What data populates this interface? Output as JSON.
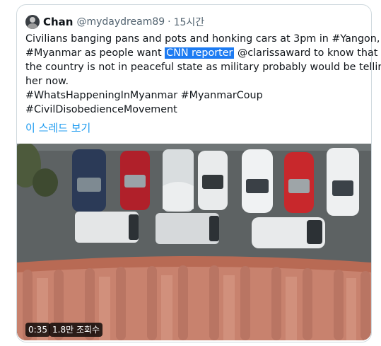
{
  "tweet": {
    "author_name": "Chan",
    "handle": "@mydaydream89",
    "separator": "·",
    "time": "15시간",
    "text_lines": [
      {
        "before": "Civilians banging pans and pots and honking cars at 3pm in #Yangon,",
        "highlight": "",
        "after": ""
      },
      {
        "before": "#Myanmar as people want ",
        "highlight": "CNN reporter",
        "after": " @clarissaward to know that"
      },
      {
        "before": "the country is not in peaceful state as military probably would be telling",
        "highlight": "",
        "after": ""
      },
      {
        "before": "her now.",
        "highlight": "",
        "after": ""
      },
      {
        "before": "#WhatsHappeningInMyanmar #MyanmarCoup",
        "highlight": "",
        "after": ""
      },
      {
        "before": "#CivilDisobedienceMovement",
        "highlight": "",
        "after": ""
      }
    ],
    "thread_link": "이 스레드 보기"
  },
  "video": {
    "duration": "0:35",
    "views": "1.8만 조회수"
  },
  "colors": {
    "link": "#1d9bf0",
    "highlight_bg": "#1d7bf2",
    "text": "#0f1419",
    "muted": "#536471",
    "border": "#cfd9de"
  },
  "icons": {
    "avatar": "avatar"
  }
}
